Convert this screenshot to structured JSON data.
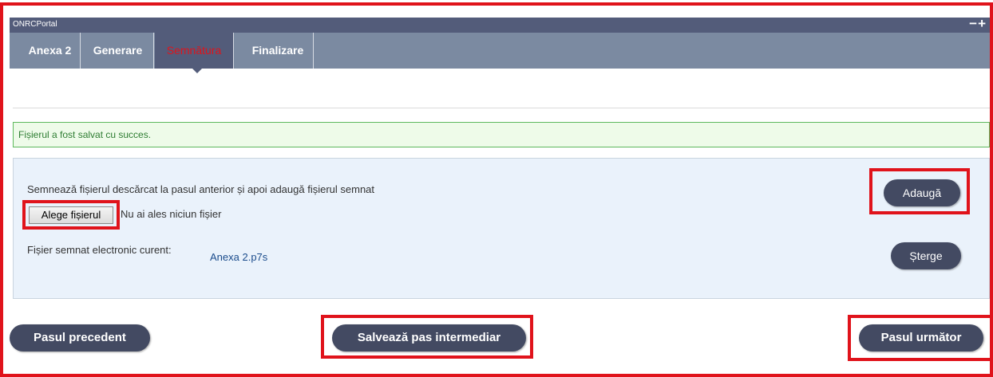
{
  "portal": {
    "title": "ONRCPortal",
    "controls": "−+"
  },
  "tabs": [
    {
      "label": "Anexa 2"
    },
    {
      "label": "Generare"
    },
    {
      "label": "Semnătura"
    },
    {
      "label": "Finalizare"
    }
  ],
  "alert": {
    "message": "Fișierul a fost salvat cu succes."
  },
  "upload": {
    "instruction": "Semnează fișierul descărcat la pasul anterior și apoi adaugă fișierul semnat",
    "choose_label": "Alege fișierul",
    "no_file_text": "Nu ai ales niciun fișier",
    "add_label": "Adaugă",
    "current_label": "Fișier semnat electronic curent:",
    "current_file": "Anexa 2.p7s",
    "delete_label": "Șterge"
  },
  "nav": {
    "prev_label": "Pasul precedent",
    "save_label": "Salvează pas intermediar",
    "next_label": "Pasul următor"
  },
  "colors": {
    "header": "#535c7a",
    "tabbar": "#7b8aa1",
    "active_tab_text": "#e0131b",
    "button": "#434a62",
    "highlight": "#e0131b"
  }
}
